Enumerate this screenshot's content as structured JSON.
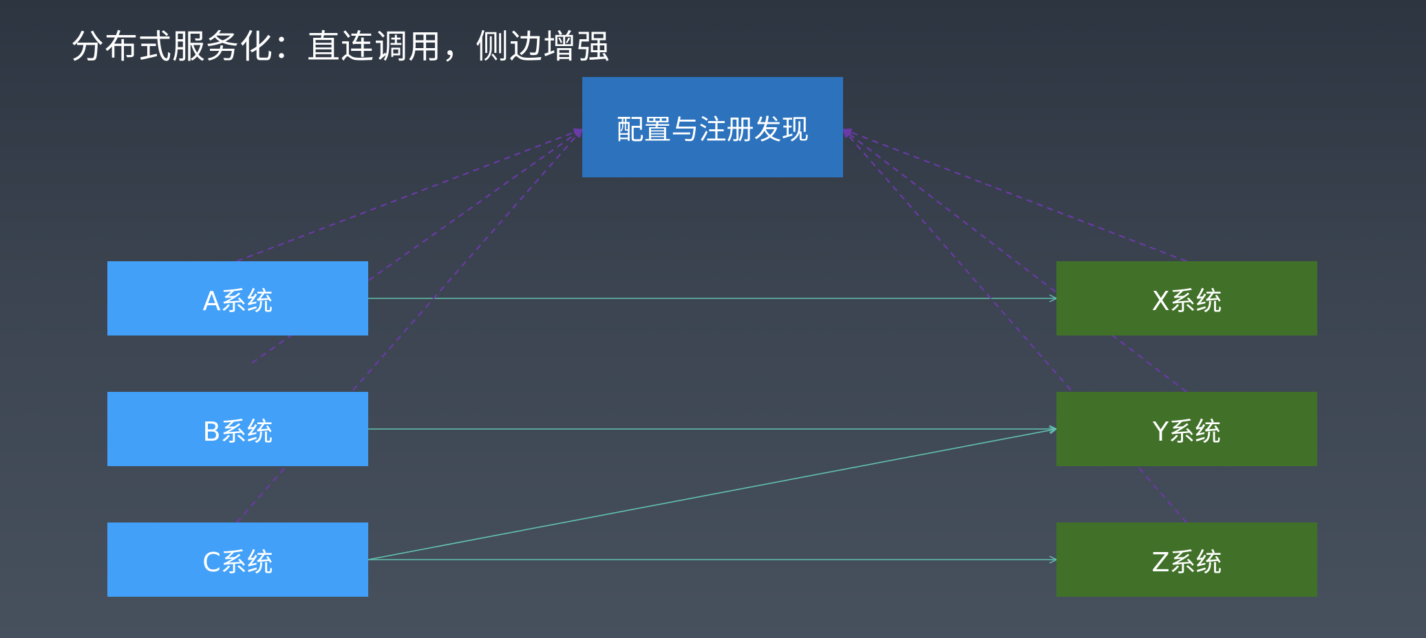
{
  "title": "分布式服务化：直连调用，侧边增强",
  "registry": {
    "label": "配置与注册发现"
  },
  "clients": [
    {
      "id": "a",
      "label": "A系统"
    },
    {
      "id": "b",
      "label": "B系统"
    },
    {
      "id": "c",
      "label": "C系统"
    }
  ],
  "servers": [
    {
      "id": "x",
      "label": "X系统"
    },
    {
      "id": "y",
      "label": "Y系统"
    },
    {
      "id": "z",
      "label": "Z系统"
    }
  ],
  "calls": [
    {
      "from": "a",
      "to": "x"
    },
    {
      "from": "b",
      "to": "y"
    },
    {
      "from": "c",
      "to": "y"
    },
    {
      "from": "c",
      "to": "z"
    }
  ],
  "registrations": [
    "a",
    "b",
    "c",
    "x",
    "y",
    "z"
  ],
  "colors": {
    "call_line": "#63c2b0",
    "registration_line": "#6b3aa8",
    "client_fill": "#42a0f8",
    "server_fill": "#417129",
    "registry_fill": "#2c72bd"
  }
}
